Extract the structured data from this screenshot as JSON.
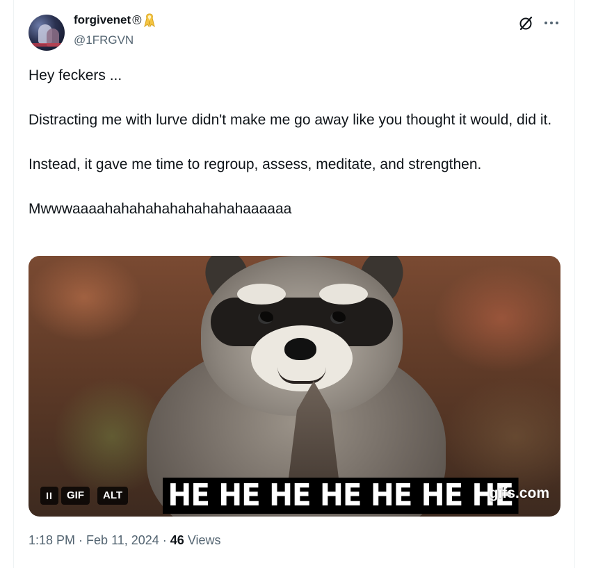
{
  "author": {
    "display_name": "forgivenet",
    "registered_mark": "®",
    "handle": "@1FRGVN",
    "ribbon_color": "#f5c542"
  },
  "tweet": {
    "lines": [
      "Hey feckers ...",
      "Distracting me with lurve didn't make me go away like you thought it would, did it.",
      "Instead, it gave me time to regroup, assess, meditate, and strengthen.",
      "Mwwwaaaahahahahahahahahahaaaaaa"
    ]
  },
  "media": {
    "caption": "HE HE HE HE HE HE HE",
    "brand": "gifs.com",
    "gif_badge": "GIF",
    "alt_badge": "ALT",
    "pause_symbol": "II"
  },
  "meta": {
    "time": "1:18 PM",
    "separator1": " · ",
    "date": "Feb 11, 2024",
    "separator2": " · ",
    "views_count": "46",
    "views_label": " Views"
  },
  "icons": {
    "grok": "grok-icon",
    "more": "more-icon",
    "ribbon": "ribbon-icon"
  },
  "colors": {
    "text_primary": "#0f1419",
    "text_secondary": "#536471"
  }
}
